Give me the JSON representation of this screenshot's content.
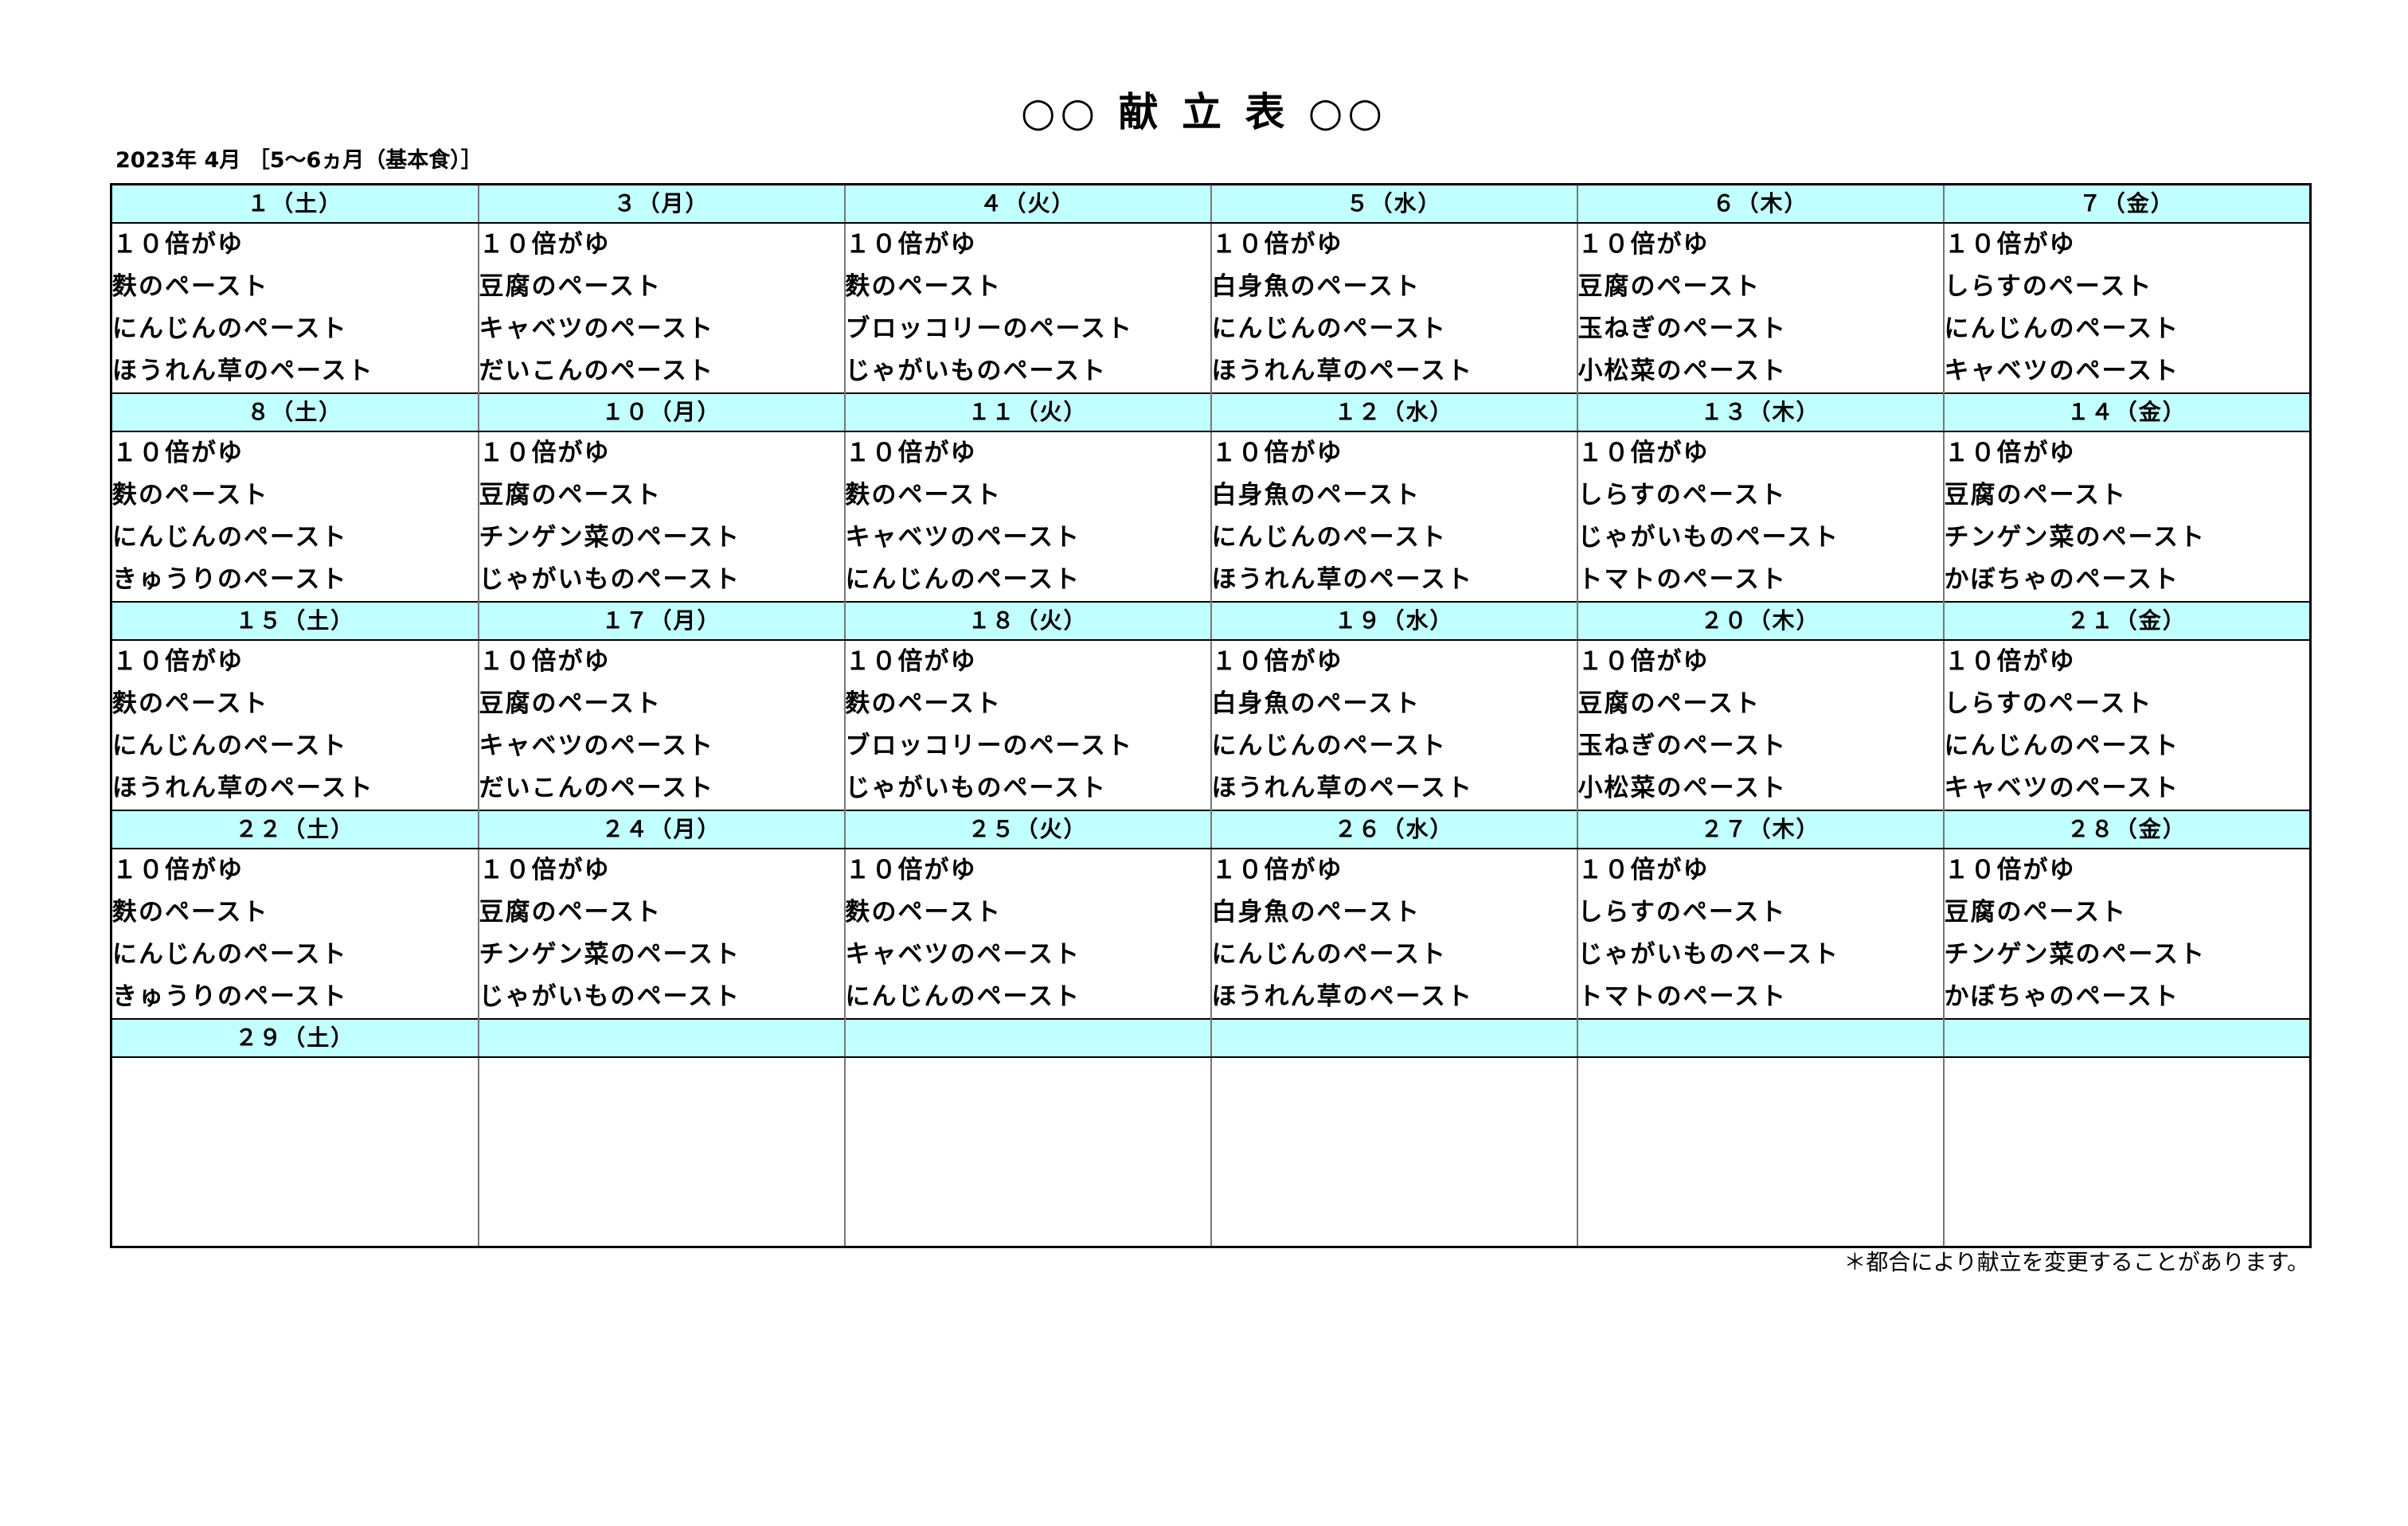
{
  "title": "○○ 献 立 表 ○○",
  "subtitle": "2023年 4月 ［5～6ヵ月（基本食）］",
  "weeks": [
    {
      "dates": [
        "１（土）",
        "３（月）",
        "４（火）",
        "５（水）",
        "６（木）",
        "７（金）"
      ],
      "menus": [
        [
          "１０倍がゆ",
          "麩のペースト",
          "にんじんのペースト",
          "ほうれん草のペースト"
        ],
        [
          "１０倍がゆ",
          "豆腐のペースト",
          "キャベツのペースト",
          "だいこんのペースト"
        ],
        [
          "１０倍がゆ",
          "麩のペースト",
          "ブロッコリーのペースト",
          "じゃがいものペースト"
        ],
        [
          "１０倍がゆ",
          "白身魚のペースト",
          "にんじんのペースト",
          "ほうれん草のペースト"
        ],
        [
          "１０倍がゆ",
          "豆腐のペースト",
          "玉ねぎのペースト",
          "小松菜のペースト"
        ],
        [
          "１０倍がゆ",
          "しらすのペースト",
          "にんじんのペースト",
          "キャベツのペースト"
        ]
      ]
    },
    {
      "dates": [
        "８（土）",
        "１０（月）",
        "１１（火）",
        "１２（水）",
        "１３（木）",
        "１４（金）"
      ],
      "menus": [
        [
          "１０倍がゆ",
          "麩のペースト",
          "にんじんのペースト",
          "きゅうりのペースト"
        ],
        [
          "１０倍がゆ",
          "豆腐のペースト",
          "チンゲン菜のペースト",
          "じゃがいものペースト"
        ],
        [
          "１０倍がゆ",
          "麩のペースト",
          "キャベツのペースト",
          "にんじんのペースト"
        ],
        [
          "１０倍がゆ",
          "白身魚のペースト",
          "にんじんのペースト",
          "ほうれん草のペースト"
        ],
        [
          "１０倍がゆ",
          "しらすのペースト",
          "じゃがいものペースト",
          "トマトのペースト"
        ],
        [
          "１０倍がゆ",
          "豆腐のペースト",
          "チンゲン菜のペースト",
          "かぼちゃのペースト"
        ]
      ]
    },
    {
      "dates": [
        "１５（土）",
        "１７（月）",
        "１８（火）",
        "１９（水）",
        "２０（木）",
        "２１（金）"
      ],
      "menus": [
        [
          "１０倍がゆ",
          "麩のペースト",
          "にんじんのペースト",
          "ほうれん草のペースト"
        ],
        [
          "１０倍がゆ",
          "豆腐のペースト",
          "キャベツのペースト",
          "だいこんのペースト"
        ],
        [
          "１０倍がゆ",
          "麩のペースト",
          "ブロッコリーのペースト",
          "じゃがいものペースト"
        ],
        [
          "１０倍がゆ",
          "白身魚のペースト",
          "にんじんのペースト",
          "ほうれん草のペースト"
        ],
        [
          "１０倍がゆ",
          "豆腐のペースト",
          "玉ねぎのペースト",
          "小松菜のペースト"
        ],
        [
          "１０倍がゆ",
          "しらすのペースト",
          "にんじんのペースト",
          "キャベツのペースト"
        ]
      ]
    },
    {
      "dates": [
        "２２（土）",
        "２４（月）",
        "２５（火）",
        "２６（水）",
        "２７（木）",
        "２８（金）"
      ],
      "menus": [
        [
          "１０倍がゆ",
          "麩のペースト",
          "にんじんのペースト",
          "きゅうりのペースト"
        ],
        [
          "１０倍がゆ",
          "豆腐のペースト",
          "チンゲン菜のペースト",
          "じゃがいものペースト"
        ],
        [
          "１０倍がゆ",
          "麩のペースト",
          "キャベツのペースト",
          "にんじんのペースト"
        ],
        [
          "１０倍がゆ",
          "白身魚のペースト",
          "にんじんのペースト",
          "ほうれん草のペースト"
        ],
        [
          "１０倍がゆ",
          "しらすのペースト",
          "じゃがいものペースト",
          "トマトのペースト"
        ],
        [
          "１０倍がゆ",
          "豆腐のペースト",
          "チンゲン菜のペースト",
          "かぼちゃのペースト"
        ]
      ]
    },
    {
      "dates": [
        "２９（土）",
        "",
        "",
        "",
        "",
        ""
      ],
      "menus": [
        [],
        [],
        [],
        [],
        [],
        []
      ]
    }
  ],
  "footnote": "＊都合により献立を変更することがあります。",
  "colors": {
    "header_bg": "#c2ffff",
    "border": "#000000"
  }
}
